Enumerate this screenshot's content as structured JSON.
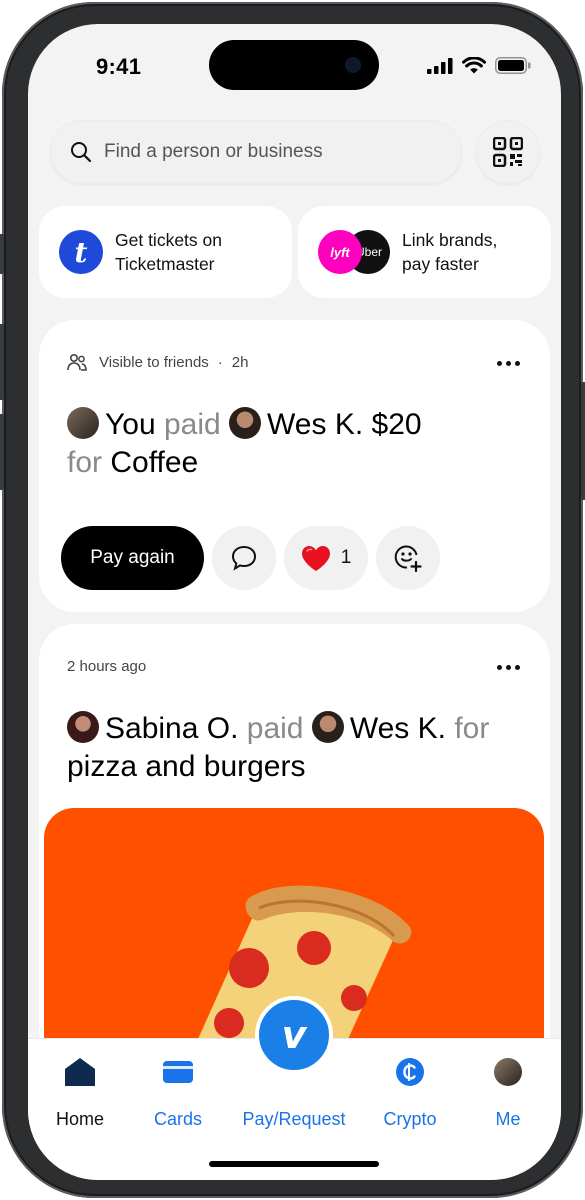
{
  "status": {
    "time": "9:41"
  },
  "search": {
    "placeholder": "Find a person or business"
  },
  "promos": [
    {
      "line1": "Get tickets on",
      "line2": "Ticketmaster",
      "logo": "t"
    },
    {
      "line1": "Link brands,",
      "line2": "pay faster",
      "logo_a": "lyft",
      "logo_b": "Uber"
    }
  ],
  "feed": [
    {
      "visibility": "Visible to friends",
      "dot": "·",
      "time": "2h",
      "payer": "You",
      "verb": "paid",
      "payee": "Wes K.",
      "amount": "$20",
      "for_word": "for",
      "note": "Coffee",
      "pay_again": "Pay again",
      "likes": "1"
    },
    {
      "time": "2 hours ago",
      "payer": "Sabina O.",
      "verb": "paid",
      "payee": "Wes K.",
      "for_word": "for",
      "note": "pizza and burgers"
    }
  ],
  "tabs": [
    {
      "label": "Home"
    },
    {
      "label": "Cards"
    },
    {
      "label": "Pay/Request"
    },
    {
      "label": "Crypto"
    },
    {
      "label": "Me"
    }
  ],
  "fab": {
    "glyph": "v"
  },
  "colors": {
    "accent": "#1a73e8",
    "venmo_blue": "#1a7fe6",
    "pizza_bg": "#ff5000",
    "ticketmaster": "#1f49d9",
    "lyft": "#ff00bf"
  }
}
